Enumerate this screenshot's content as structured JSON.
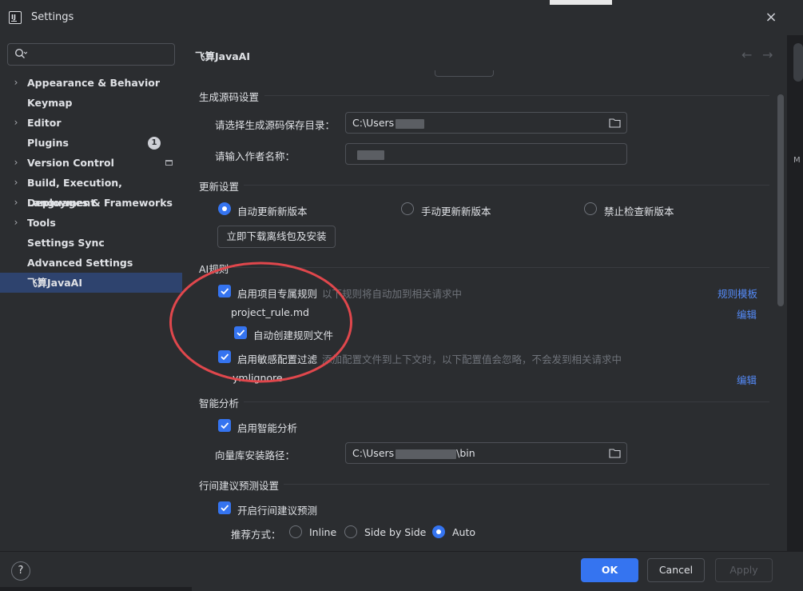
{
  "window": {
    "title": "Settings",
    "close_icon": "×"
  },
  "sidebar": {
    "search_placeholder": "",
    "items": [
      {
        "label": "Appearance & Behavior",
        "expandable": true
      },
      {
        "label": "Keymap",
        "expandable": false
      },
      {
        "label": "Editor",
        "expandable": true
      },
      {
        "label": "Plugins",
        "expandable": false,
        "badge": "1"
      },
      {
        "label": "Version Control",
        "expandable": true
      },
      {
        "label": "Build, Execution, Deployment",
        "expandable": true
      },
      {
        "label": "Languages & Frameworks",
        "expandable": true
      },
      {
        "label": "Tools",
        "expandable": true
      },
      {
        "label": "Settings Sync",
        "expandable": false
      },
      {
        "label": "Advanced Settings",
        "expandable": false
      },
      {
        "label": "飞算JavaAI",
        "expandable": false,
        "selected": true
      }
    ]
  },
  "main": {
    "title": "飞算JavaAI",
    "back_icon": "←",
    "forward_icon": "→",
    "generate": {
      "section": "生成源码设置",
      "dir_label": "请选择生成源码保存目录：",
      "dir_value": "C:\\Users",
      "author_label": "请输入作者名称："
    },
    "update": {
      "section": "更新设置",
      "options": [
        "自动更新新版本",
        "手动更新新版本",
        "禁止检查新版本"
      ],
      "selected": 0,
      "download_button": "立即下载离线包及安装"
    },
    "ai_rules": {
      "section": "AI规则",
      "project_rules_label": "启用项目专属规则",
      "project_rules_hint": "以下规则将自动加到相关请求中",
      "rule_template_link": "规则模板",
      "rule_file": "project_rule.md",
      "edit_link_1": "编辑",
      "auto_create_label": "自动创建规则文件",
      "sensitive_label": "启用敏感配置过滤",
      "sensitive_hint": "添加配置文件到上下文时，以下配置值会忽略，不会发到相关请求中",
      "ignore_file": "ymlignore",
      "edit_link_2": "编辑"
    },
    "analysis": {
      "section": "智能分析",
      "enable_label": "启用智能分析",
      "vector_label": "向量库安装路径：",
      "vector_prefix": "C:\\Users",
      "vector_suffix": "\\bin"
    },
    "inline": {
      "section": "行间建议预测设置",
      "enable_label": "开启行间建议预测",
      "mode_label": "推荐方式：",
      "modes": [
        "Inline",
        "Side by Side",
        "Auto"
      ],
      "selected": 2
    }
  },
  "footer": {
    "help": "?",
    "ok": "OK",
    "cancel": "Cancel",
    "apply": "Apply"
  },
  "edge_text": "M",
  "colors": {
    "background": "#2b2d30",
    "accent": "#3574f0",
    "link": "#548af7",
    "selection": "#2e436e",
    "annotation": "#e0474c"
  }
}
